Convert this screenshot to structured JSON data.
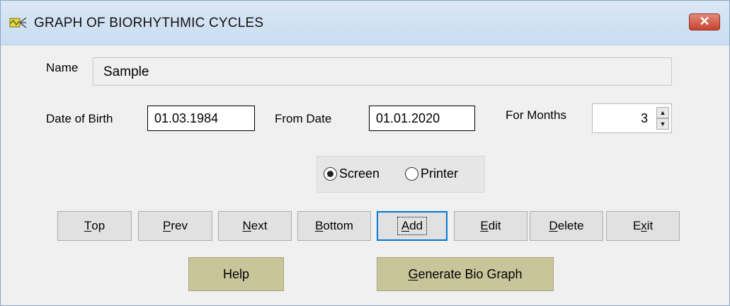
{
  "window": {
    "title": "GRAPH OF BIORHYTHMIC CYCLES",
    "icon": "biorhythm-app-icon",
    "close_label": "✕"
  },
  "form": {
    "name_label": "Name",
    "name_value": "Sample",
    "dob_label": "Date of Birth",
    "dob_value": "01.03.1984",
    "from_label": "From Date",
    "from_value": "01.01.2020",
    "months_label": "For Months",
    "months_value": "3"
  },
  "output": {
    "options": [
      {
        "label": "Screen",
        "selected": true
      },
      {
        "label": "Printer",
        "selected": false
      }
    ]
  },
  "nav_buttons": [
    {
      "accel": "T",
      "rest": "op"
    },
    {
      "accel": "P",
      "rest": "rev"
    },
    {
      "accel": "N",
      "rest": "ext"
    },
    {
      "accel": "B",
      "rest": "ottom"
    },
    {
      "accel": "A",
      "rest": "dd",
      "focused": true
    },
    {
      "accel": "E",
      "rest": "dit"
    },
    {
      "accel": "D",
      "rest": "elete"
    },
    {
      "pre": "E",
      "accel": "x",
      "rest": "it"
    }
  ],
  "action_buttons": {
    "help_label": "Help",
    "generate_accel": "G",
    "generate_rest": "enerate Bio Graph"
  },
  "colors": {
    "action_button_bg": "#c8c59a",
    "focus_border": "#0078d7",
    "close_button": "#c7432d"
  }
}
